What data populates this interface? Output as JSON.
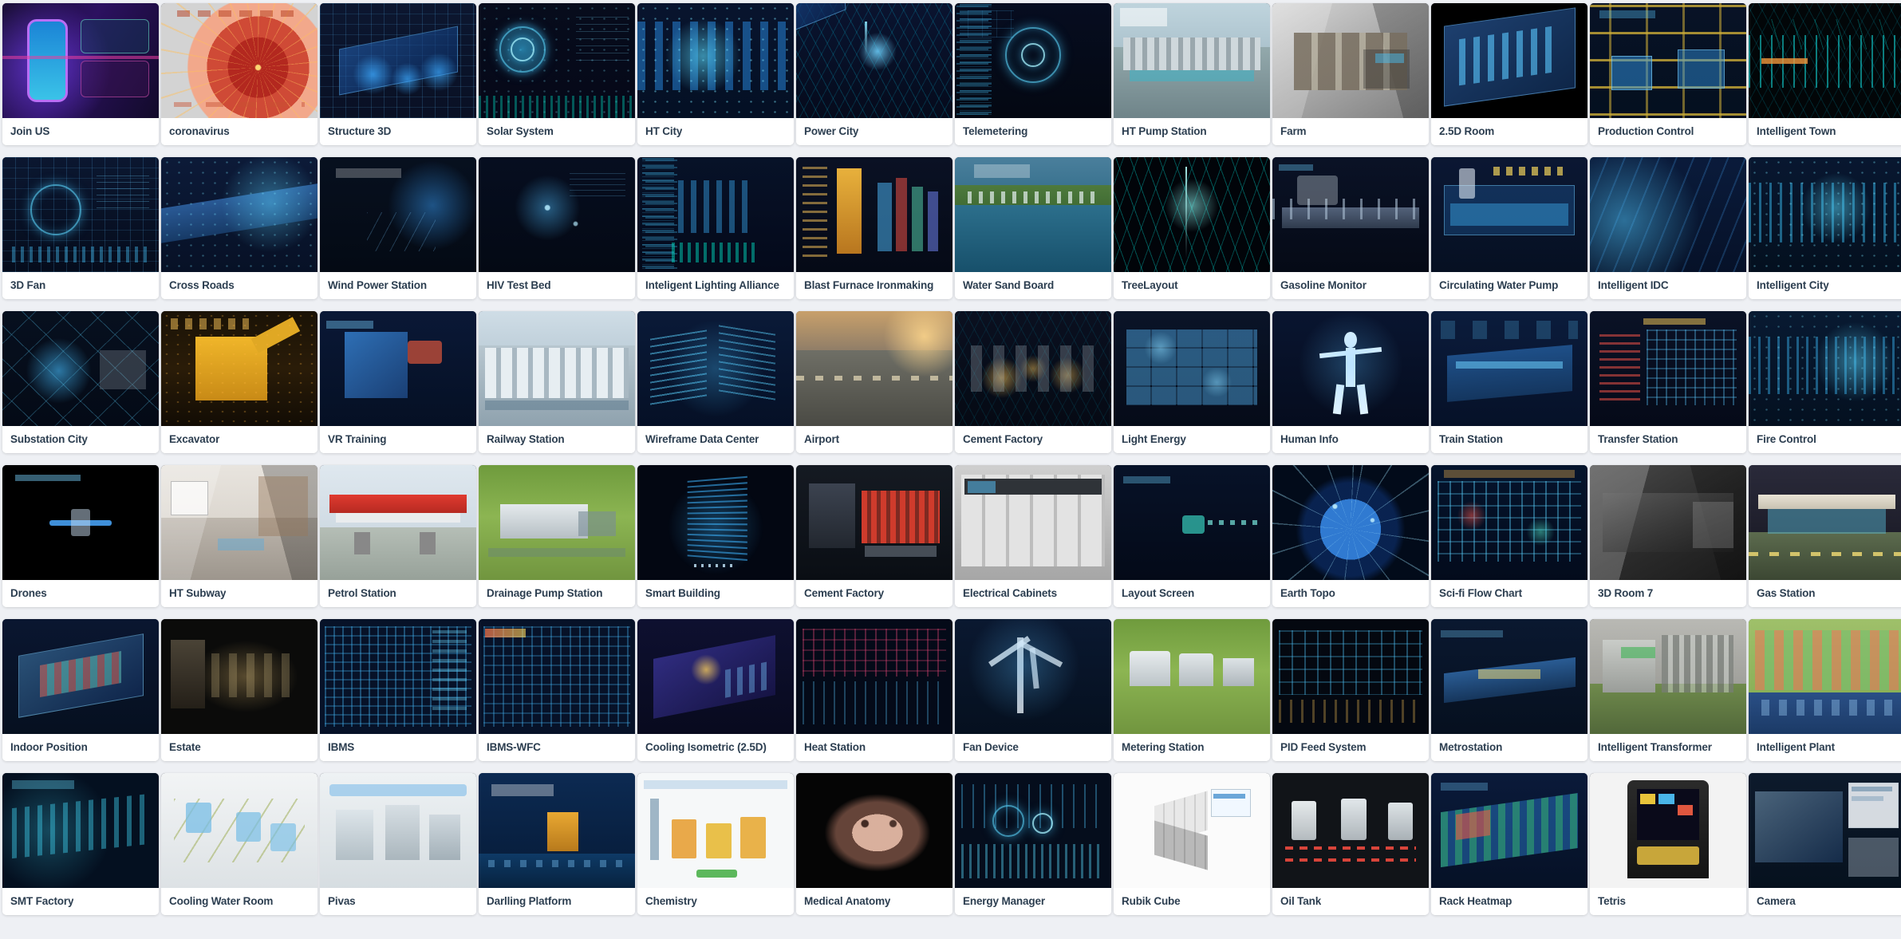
{
  "page": {
    "background_color": "#eef0f4",
    "card_background": "#ffffff",
    "label_color": "#2c3e50",
    "columns": 12,
    "rows": 6,
    "total_cards": 72
  },
  "cards": [
    {
      "label": "Join US",
      "scene": "join-us"
    },
    {
      "label": "coronavirus",
      "scene": "coronavirus"
    },
    {
      "label": "Structure 3D",
      "scene": "structure-3d"
    },
    {
      "label": "Solar System",
      "scene": "solar-system"
    },
    {
      "label": "HT City",
      "scene": "ht-city"
    },
    {
      "label": "Power City",
      "scene": "power-city"
    },
    {
      "label": "Telemetering",
      "scene": "telemetering"
    },
    {
      "label": "HT Pump Station",
      "scene": "ht-pump-station"
    },
    {
      "label": "Farm",
      "scene": "farm"
    },
    {
      "label": "2.5D Room",
      "scene": "room-25d"
    },
    {
      "label": "Production Control",
      "scene": "production-control"
    },
    {
      "label": "Intelligent Town",
      "scene": "intelligent-town"
    },
    {
      "label": "3D Fan",
      "scene": "3d-fan"
    },
    {
      "label": "Cross Roads",
      "scene": "cross-roads"
    },
    {
      "label": "Wind Power Station",
      "scene": "wind-power-station"
    },
    {
      "label": "HIV Test Bed",
      "scene": "hiv-test-bed"
    },
    {
      "label": "Inteligent Lighting Alliance",
      "scene": "lighting-alliance"
    },
    {
      "label": "Blast Furnace Ironmaking",
      "scene": "blast-furnace"
    },
    {
      "label": "Water Sand Board",
      "scene": "water-sand-board"
    },
    {
      "label": "TreeLayout",
      "scene": "tree-layout"
    },
    {
      "label": "Gasoline Monitor",
      "scene": "gasoline-monitor"
    },
    {
      "label": "Circulating Water Pump",
      "scene": "circulating-water-pump"
    },
    {
      "label": "Intelligent IDC",
      "scene": "intelligent-idc"
    },
    {
      "label": "Intelligent City",
      "scene": "intelligent-city"
    },
    {
      "label": "Substation City",
      "scene": "substation-city"
    },
    {
      "label": "Excavator",
      "scene": "excavator"
    },
    {
      "label": "VR Training",
      "scene": "vr-training"
    },
    {
      "label": "Railway Station",
      "scene": "railway-station"
    },
    {
      "label": "Wireframe Data Center",
      "scene": "wireframe-data-center"
    },
    {
      "label": "Airport",
      "scene": "airport"
    },
    {
      "label": "Cement Factory",
      "scene": "cement-factory-1"
    },
    {
      "label": "Light Energy",
      "scene": "light-energy"
    },
    {
      "label": "Human Info",
      "scene": "human-info"
    },
    {
      "label": "Train Station",
      "scene": "train-station"
    },
    {
      "label": "Transfer Station",
      "scene": "transfer-station"
    },
    {
      "label": "Fire Control",
      "scene": "fire-control"
    },
    {
      "label": "Drones",
      "scene": "drones"
    },
    {
      "label": "HT Subway",
      "scene": "ht-subway"
    },
    {
      "label": "Petrol Station",
      "scene": "petrol-station"
    },
    {
      "label": "Drainage Pump Station",
      "scene": "drainage-pump-station"
    },
    {
      "label": "Smart Building",
      "scene": "smart-building"
    },
    {
      "label": "Cement Factory",
      "scene": "cement-factory-2"
    },
    {
      "label": "Electrical Cabinets",
      "scene": "electrical-cabinets"
    },
    {
      "label": "Layout Screen",
      "scene": "layout-screen"
    },
    {
      "label": "Earth Topo",
      "scene": "earth-topo"
    },
    {
      "label": "Sci-fi Flow Chart",
      "scene": "scifi-flow-chart"
    },
    {
      "label": "3D Room 7",
      "scene": "3d-room-7"
    },
    {
      "label": "Gas Station",
      "scene": "gas-station"
    },
    {
      "label": "Indoor Position",
      "scene": "indoor-position"
    },
    {
      "label": "Estate",
      "scene": "estate"
    },
    {
      "label": "IBMS",
      "scene": "ibms"
    },
    {
      "label": "IBMS-WFC",
      "scene": "ibms-wfc"
    },
    {
      "label": "Cooling Isometric (2.5D)",
      "scene": "cooling-isometric"
    },
    {
      "label": "Heat Station",
      "scene": "heat-station"
    },
    {
      "label": "Fan Device",
      "scene": "fan-device"
    },
    {
      "label": "Metering Station",
      "scene": "metering-station"
    },
    {
      "label": "PID Feed System",
      "scene": "pid-feed-system"
    },
    {
      "label": "Metrostation",
      "scene": "metrostation"
    },
    {
      "label": "Intelligent Transformer",
      "scene": "intelligent-transformer"
    },
    {
      "label": "Intelligent Plant",
      "scene": "intelligent-plant"
    },
    {
      "label": "SMT Factory",
      "scene": "smt-factory"
    },
    {
      "label": "Cooling Water Room",
      "scene": "cooling-water-room"
    },
    {
      "label": "Pivas",
      "scene": "pivas"
    },
    {
      "label": "Darlling Platform",
      "scene": "darlling-platform"
    },
    {
      "label": "Chemistry",
      "scene": "chemistry"
    },
    {
      "label": "Medical Anatomy",
      "scene": "medical-anatomy"
    },
    {
      "label": "Energy Manager",
      "scene": "energy-manager"
    },
    {
      "label": "Rubik Cube",
      "scene": "rubik-cube"
    },
    {
      "label": "Oil Tank",
      "scene": "oil-tank"
    },
    {
      "label": "Rack Heatmap",
      "scene": "rack-heatmap"
    },
    {
      "label": "Tetris",
      "scene": "tetris"
    },
    {
      "label": "Camera",
      "scene": "camera"
    }
  ]
}
